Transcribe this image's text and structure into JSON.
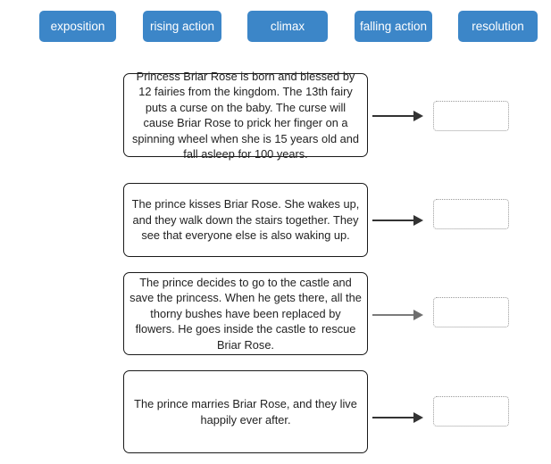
{
  "activity": {
    "type": "drag-and-drop-matching",
    "accent_color": "#3c86c8",
    "background_color": "#ffffff",
    "box_border_color": "#1a1a1a",
    "drop_border_color": "#9a9a9a"
  },
  "tag_bank": {
    "tags": [
      {
        "label": "exposition"
      },
      {
        "label": "rising action"
      },
      {
        "label": "climax"
      },
      {
        "label": "falling action"
      },
      {
        "label": "resolution"
      }
    ]
  },
  "rows": [
    {
      "description": "Princess Briar Rose is born and blessed by 12 fairies from the kingdom. The 13th fairy puts a curse on the baby. The curse will cause Briar Rose to prick her finger on a spinning wheel when she is 15 years old and fall asleep for 100 years.",
      "arrow_style": "dark",
      "answer": ""
    },
    {
      "description": "The prince kisses Briar Rose. She wakes up, and they walk down the stairs together. They see that everyone else is also waking up.",
      "arrow_style": "dark",
      "answer": ""
    },
    {
      "description": "The prince decides to go to the castle and save the princess. When he gets there, all the thorny bushes have been replaced by flowers. He goes inside the castle to rescue Briar Rose.",
      "arrow_style": "gray",
      "answer": ""
    },
    {
      "description": "The prince marries Briar Rose, and they live happily ever after.",
      "arrow_style": "dark",
      "answer": ""
    }
  ]
}
